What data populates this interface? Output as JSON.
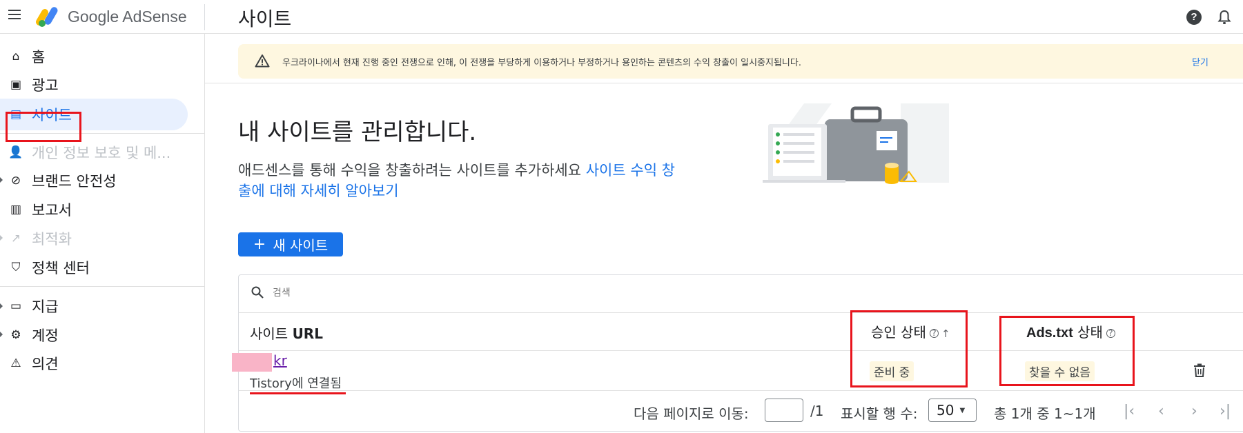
{
  "app": {
    "product": "Google AdSense",
    "page_title": "사이트"
  },
  "sidebar": {
    "items": [
      {
        "label": "홈",
        "icon": "home-icon"
      },
      {
        "label": "광고",
        "icon": "ads-icon"
      },
      {
        "label": "사이트",
        "icon": "sites-icon",
        "active": true
      },
      {
        "label": "개인 정보 보호 및 메...",
        "icon": "privacy-icon",
        "disabled": true
      },
      {
        "label": "브랜드 안전성",
        "icon": "block-icon"
      },
      {
        "label": "보고서",
        "icon": "reports-icon"
      },
      {
        "label": "최적화",
        "icon": "trending-icon",
        "disabled": true
      },
      {
        "label": "정책 센터",
        "icon": "policy-icon"
      },
      {
        "label": "지급",
        "icon": "payments-icon"
      },
      {
        "label": "계정",
        "icon": "gear-icon"
      },
      {
        "label": "의견",
        "icon": "feedback-icon"
      }
    ]
  },
  "banner": {
    "text": "우크라이나에서 현재 진행 중인 전쟁으로 인해, 이 전쟁을 부당하게 이용하거나 부정하거나 용인하는 콘텐츠의 수익 창출이 일시중지됩니다.",
    "close_label": "닫기"
  },
  "main": {
    "headline": "내 사이트를 관리합니다.",
    "description": "애드센스를 통해 수익을 창출하려는 사이트를 추가하세요 ",
    "learn_more": "사이트 수익 창출에 대해 자세히 알아보기",
    "new_site_button": "새 사이트"
  },
  "table": {
    "search_placeholder": "검색",
    "headers": {
      "url": "사이트 ",
      "url_bold": "URL",
      "approval": "승인 상태",
      "ads_bold": "Ads.txt",
      "ads": " 상태"
    },
    "rows": [
      {
        "url": "kr",
        "linked_platform": "Tistory",
        "linked_suffix": "에 연결됨",
        "approval_status": "준비 중",
        "ads_txt_status": "찾을 수 없음"
      }
    ]
  },
  "pagination": {
    "goto_label": "다음 페이지로 이동:",
    "goto_value": "",
    "total_pages": "/1",
    "rows_label": "표시할 행 수:",
    "rows_value": "50",
    "range_label": "총 1개 중 1~1개"
  },
  "colors": {
    "accent": "#1a73e8",
    "highlight": "#e8141c",
    "banner_bg": "#fef7e0",
    "redacted": "#f9b4c7"
  }
}
